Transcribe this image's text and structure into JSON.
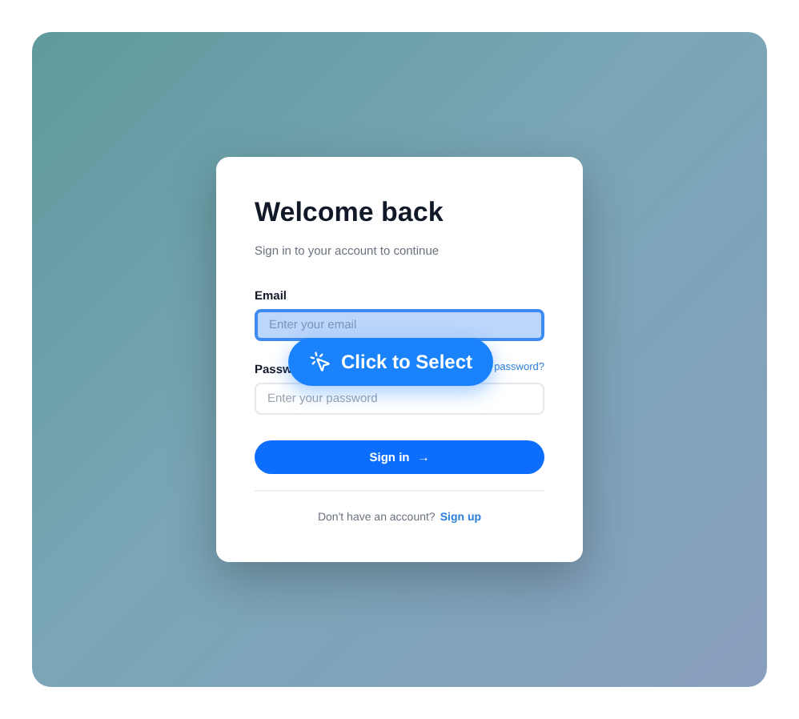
{
  "card": {
    "title": "Welcome back",
    "subtitle": "Sign in to your account to continue",
    "fields": [
      {
        "label": "Email",
        "placeholder": "Enter your email",
        "focused": true
      },
      {
        "label": "Passw",
        "placeholder": "Enter your password",
        "focused": false,
        "link": "password?"
      }
    ],
    "submit": {
      "label": "Sign in",
      "arrow": "→"
    },
    "footer": {
      "text": "Don't have an account?",
      "link": "Sign up"
    }
  },
  "overlay": {
    "label": "Click to Select"
  }
}
